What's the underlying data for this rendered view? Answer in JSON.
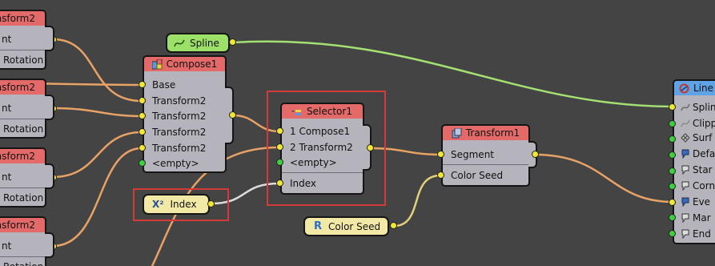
{
  "colors": {
    "background": "#444444",
    "node_header": "#e46a6a",
    "node_header_blue": "#5fa3e6",
    "node_body": "#b5b4bc",
    "spline_pill": "#9ce06a",
    "index_pill": "#f3e9a6",
    "colorseed_pill": "#f3e9a6",
    "wire_orange": "#e8a265",
    "wire_green": "#a4e072",
    "wire_white": "#dcdcdc",
    "wire_yellow": "#e2d07a",
    "port_yellow": "#f0e635",
    "port_green": "#3ed13e",
    "selection_outline": "#d33a3a"
  },
  "left_nodes": [
    {
      "title": "ransform2",
      "rows": [
        "nt",
        "Rotation"
      ]
    },
    {
      "title": "ransform2",
      "rows": [
        "nt",
        "Rotation"
      ]
    },
    {
      "title": "ransform2",
      "rows": [
        "nt",
        "Rotation"
      ]
    },
    {
      "title": "ransform2",
      "rows": [
        "nt",
        "Rotation"
      ]
    }
  ],
  "spline": {
    "label": "Spline",
    "icon": "spline-curve-icon"
  },
  "compose": {
    "title": "Compose1",
    "icon": "compose-icon",
    "inputs": [
      "Base",
      "Transform2",
      "Transform2",
      "Transform2",
      "Transform2",
      "<empty>"
    ]
  },
  "selector": {
    "title": "Selector1",
    "icon": "selector-icon",
    "inputs": [
      "1  Compose1",
      "2  Transform2",
      "<empty>",
      "Index"
    ]
  },
  "index": {
    "label": "Index",
    "icon": "x-squared-icon",
    "icon_text": "X²"
  },
  "color_seed": {
    "label": "Color Seed",
    "icon": "random-r-icon",
    "icon_text": "R"
  },
  "transform1": {
    "title": "Transform1",
    "icon": "transform-icon",
    "inputs": [
      "Segment",
      "Color Seed"
    ]
  },
  "line_node": {
    "title": "Line",
    "icon": "line-icon",
    "inputs": [
      {
        "label": "Splin",
        "icon": "spline-curve-icon"
      },
      {
        "label": "Clipp",
        "icon": "clipping-icon"
      },
      {
        "label": "Surf",
        "icon": "surface-icon"
      },
      {
        "label": "Defa",
        "icon": "default-style-icon"
      },
      {
        "label": "Star",
        "icon": "start-style-icon"
      },
      {
        "label": "Corn",
        "icon": "corner-style-icon"
      },
      {
        "label": "Eve",
        "icon": "every-style-icon"
      },
      {
        "label": "Mar",
        "icon": "marker-style-icon"
      },
      {
        "label": "End",
        "icon": "end-style-icon"
      }
    ]
  }
}
